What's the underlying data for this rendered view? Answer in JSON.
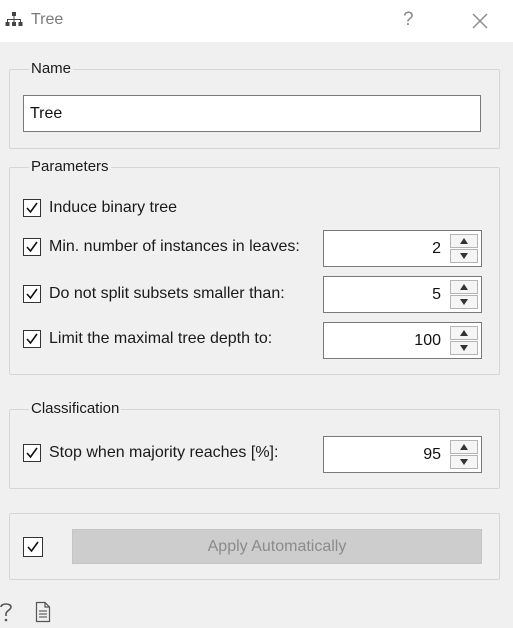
{
  "window": {
    "title": "Tree",
    "help_glyph": "?",
    "icons": {
      "app": "tree-icon",
      "help": "question-icon",
      "close": "close-icon"
    }
  },
  "name_group": {
    "title": "Name",
    "value": "Tree"
  },
  "parameters_group": {
    "title": "Parameters",
    "binary_tree": {
      "label": "Induce binary tree",
      "checked": true
    },
    "min_instances": {
      "label": "Min. number of instances in leaves:",
      "checked": true,
      "value": "2"
    },
    "min_split": {
      "label": "Do not split subsets smaller than:",
      "checked": true,
      "value": "5"
    },
    "max_depth": {
      "label": "Limit the maximal tree depth to:",
      "checked": true,
      "value": "100"
    }
  },
  "classification_group": {
    "title": "Classification",
    "majority": {
      "label": "Stop when majority reaches [%]:",
      "checked": true,
      "value": "95"
    }
  },
  "apply": {
    "checked": true,
    "button_label": "Apply Automatically",
    "enabled": false
  },
  "footer": {
    "icons": {
      "help": "question-icon",
      "report": "document-icon"
    }
  },
  "colors": {
    "background": "#f0f0f0",
    "titlebar": "#ffffff",
    "group_border": "#d6d6d6",
    "disabled_button": "#cdcdcd",
    "disabled_text": "#8b8b8b"
  }
}
